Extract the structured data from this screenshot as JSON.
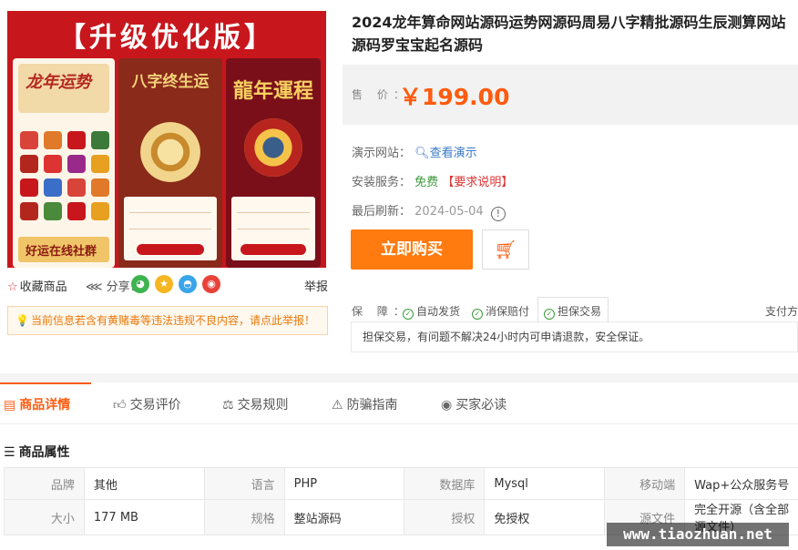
{
  "gallery": {
    "banner": "【升级优化版】",
    "panel1_title": "龙年运势",
    "panel1_bottom": "好运在线社群",
    "panel2_title": "八字终生运",
    "panel3_title": "龍年運程",
    "icon_colors": [
      "#d9443a",
      "#e07a2a",
      "#c8161d",
      "#3c7a3a",
      "#b3261e",
      "#d33",
      "#9a2a8a",
      "#e8a020",
      "#c8161d",
      "#3a6ec8",
      "#d9443a",
      "#e07a2a",
      "#b3261e",
      "#4a8a3a",
      "#c8161d",
      "#e8a020"
    ]
  },
  "actions": {
    "favorite": "收藏商品",
    "share": "分享：",
    "report": "举报",
    "share_icons": [
      {
        "name": "wechat",
        "color": "#3fb34f"
      },
      {
        "name": "qzone",
        "color": "#f5b622"
      },
      {
        "name": "qq",
        "color": "#3aa4e8"
      },
      {
        "name": "weibo",
        "color": "#e8423a"
      }
    ]
  },
  "notice": "当前信息若含有黄赌毒等违法违规不良内容，请点此举报！",
  "product": {
    "title": "2024龙年算命网站源码运势网源码周易八字精批源码生辰测算网站源码罗宝宝起名源码",
    "price_label": "售 价：",
    "price": "￥199.00",
    "demo_label": "演示网站：",
    "demo_link": "查看演示",
    "install_label": "安装服务：",
    "install_value": "免费",
    "install_req": "【要求说明】",
    "refresh_label": "最后刷新：",
    "refresh_value": "2024-05-04",
    "buy_label": "立即购买"
  },
  "guarantee": {
    "label": "保 障：",
    "items": [
      "自动发货",
      "消保赔付",
      "担保交易"
    ],
    "pay_method": "支付方",
    "description": "担保交易，有问题不解决24小时内可申请退款，安全保证。"
  },
  "tabs": [
    {
      "label": "商品详情",
      "icon": "▬"
    },
    {
      "label": "交易评价",
      "icon": "👍"
    },
    {
      "label": "交易规则",
      "icon": "⚖"
    },
    {
      "label": "防骗指南",
      "icon": "⚠"
    },
    {
      "label": "买家必读",
      "icon": "◉"
    }
  ],
  "attributes": {
    "title": "商品属性",
    "rows": [
      [
        [
          "品牌",
          "其他"
        ],
        [
          "语言",
          "PHP"
        ],
        [
          "数据库",
          "Mysql"
        ],
        [
          "移动端",
          "Wap+公众服务号"
        ]
      ],
      [
        [
          "大小",
          "177 MB"
        ],
        [
          "规格",
          "整站源码"
        ],
        [
          "授权",
          "免授权"
        ],
        [
          "源文件",
          "完全开源（含全部源文件）"
        ]
      ]
    ]
  },
  "watermark": "www.tiaozhuan.net"
}
